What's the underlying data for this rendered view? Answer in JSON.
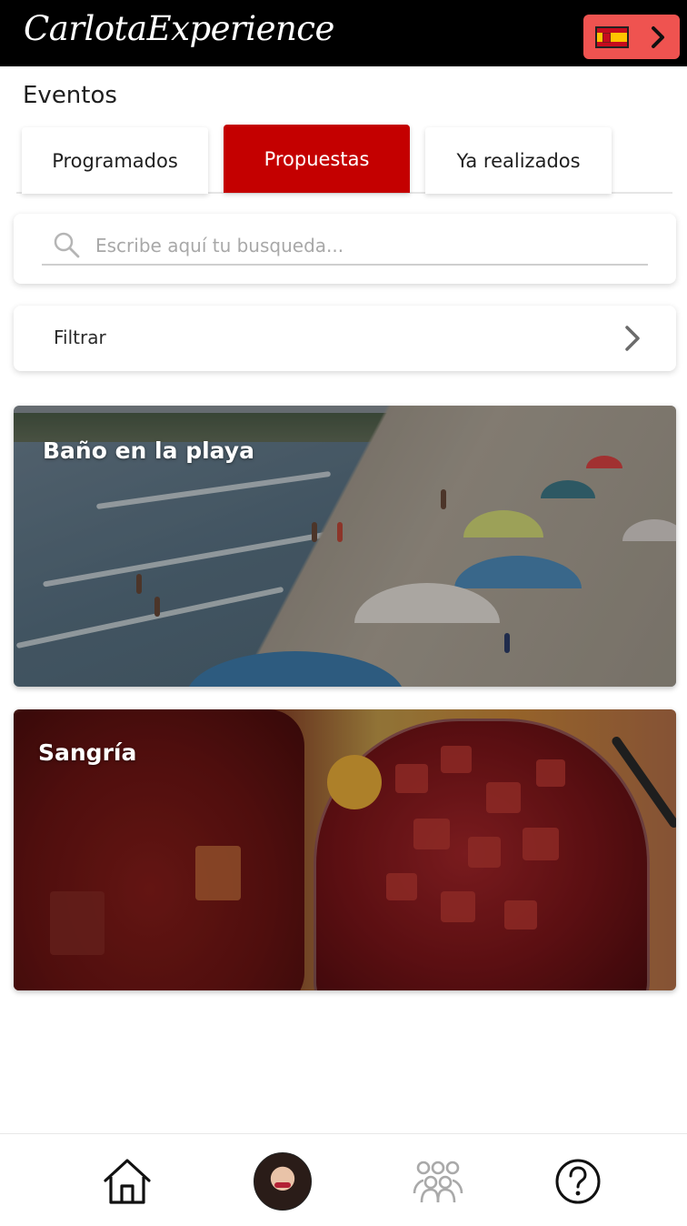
{
  "header": {
    "logo": "CarlotaExperience",
    "language": {
      "flag": "spain-flag-icon",
      "chevron": "chevron-right-icon"
    }
  },
  "section": {
    "title": "Eventos"
  },
  "tabs": [
    {
      "label": "Programados",
      "active": false
    },
    {
      "label": "Propuestas",
      "active": true
    },
    {
      "label": "Ya realizados",
      "active": false
    }
  ],
  "search": {
    "placeholder": "Escribe aquí tu busqueda...",
    "value": "",
    "icon": "search-icon"
  },
  "filter": {
    "label": "Filtrar",
    "icon": "chevron-right-icon"
  },
  "events": [
    {
      "title": "Baño en la playa",
      "image": "beach-photo"
    },
    {
      "title": "Sangría",
      "image": "sangria-photo"
    }
  ],
  "bottom_nav": {
    "items": [
      {
        "icon": "home-icon"
      },
      {
        "icon": "profile-avatar"
      },
      {
        "icon": "group-icon"
      },
      {
        "icon": "help-icon"
      }
    ]
  },
  "colors": {
    "header_bg": "#000000",
    "accent": "#c40000",
    "language_button": "#ef5350"
  }
}
